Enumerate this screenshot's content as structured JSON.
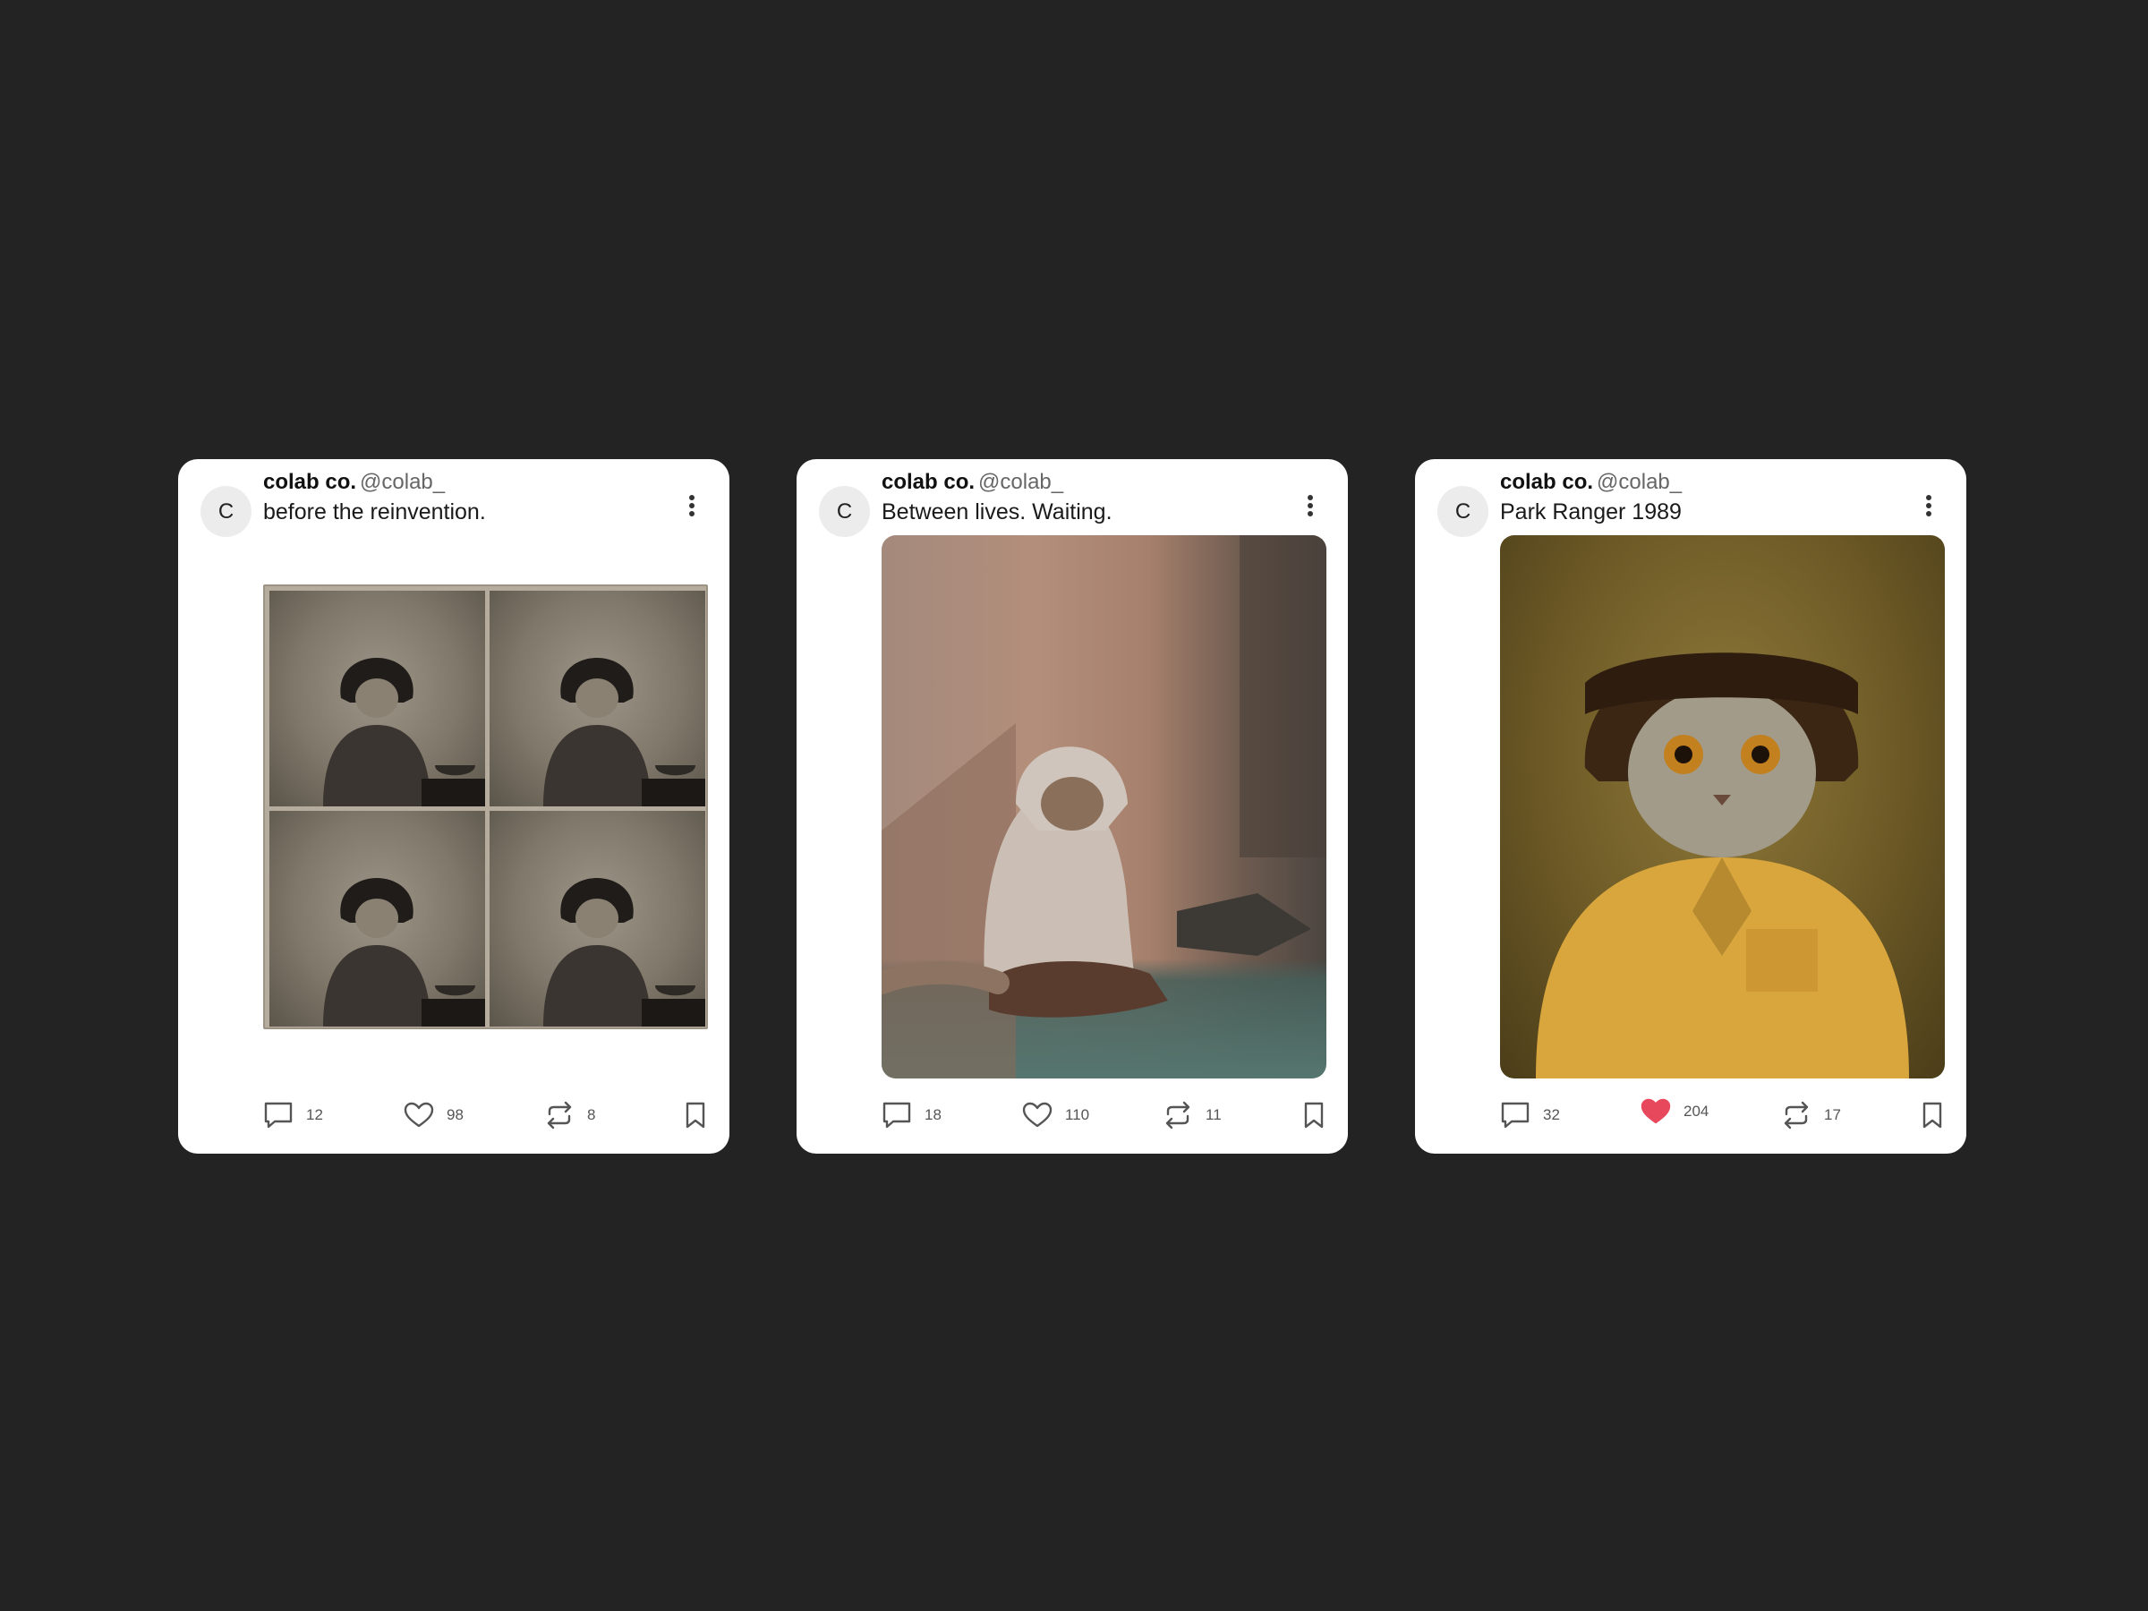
{
  "posts": [
    {
      "avatar_letter": "C",
      "author": "colab co.",
      "handle": "@colab_",
      "caption": "before the reinvention.",
      "image_alt": "sepia contact sheet",
      "comments": "12",
      "likes": "98",
      "reposts": "8",
      "liked": false
    },
    {
      "avatar_letter": "C",
      "author": "colab co.",
      "handle": "@colab_",
      "caption": "Between lives. Waiting.",
      "image_alt": "cat in hoodie",
      "comments": "18",
      "likes": "110",
      "reposts": "11",
      "liked": false
    },
    {
      "avatar_letter": "C",
      "author": "colab co.",
      "handle": "@colab_",
      "caption": "Park Ranger 1989",
      "image_alt": "cat portrait",
      "comments": "32",
      "likes": "204",
      "reposts": "17",
      "liked": true
    }
  ],
  "icons": {
    "comment": "comment-icon",
    "like": "heart-icon",
    "repost": "repost-icon",
    "bookmark": "bookmark-icon",
    "more": "more-vertical-icon"
  },
  "colors": {
    "background": "#232323",
    "card": "#ffffff",
    "like_active": "#e8485c",
    "icon": "#555555"
  }
}
